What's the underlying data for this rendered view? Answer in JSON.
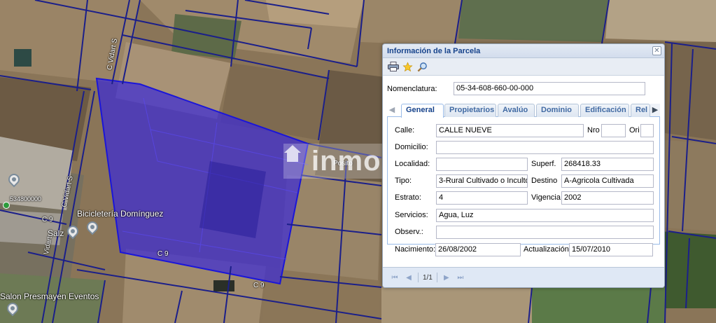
{
  "map": {
    "street_labels": [
      "C Vidart S",
      "C Vidart S",
      "C 9",
      "C 9",
      "C 9",
      "Vidart"
    ],
    "poi_labels": [
      "Bicicletería Domínguez",
      "Salz",
      "Salon Presmayen Eventos",
      "Posito"
    ],
    "parcel_number": "534800000",
    "watermark_text": "inmou",
    "parcel_fill": "#3c2bd6",
    "parcel_border": "#1a15d9",
    "line_color": "#1b1f8a"
  },
  "dialog": {
    "title": "Información de la Parcela",
    "close_icon": "close-icon",
    "toolbar": [
      "print-icon",
      "star-icon",
      "search-icon"
    ],
    "nomenclatura": {
      "label": "Nomenclatura:",
      "value": "05-34-608-660-00-000"
    },
    "tabs": [
      {
        "label": "General",
        "active": true
      },
      {
        "label": "Propietarios",
        "active": false
      },
      {
        "label": "Avalúo",
        "active": false
      },
      {
        "label": "Dominio",
        "active": false
      },
      {
        "label": "Edificación",
        "active": false
      },
      {
        "label": "Rel",
        "active": false
      }
    ],
    "general": {
      "calle_label": "Calle:",
      "calle_value": "CALLE NUEVE",
      "nro_label": "Nro",
      "nro_value": "",
      "ori_label": "Ori",
      "ori_value": "",
      "domicilio_label": "Domicilio:",
      "domicilio_value": "",
      "localidad_label": "Localidad:",
      "localidad_value": "",
      "superf_label": "Superf.",
      "superf_value": "268418.33",
      "tipo_label": "Tipo:",
      "tipo_value": "3-Rural Cultivado o Inculto",
      "destino_label": "Destino",
      "destino_value": "A-Agricola Cultivada",
      "estrato_label": "Estrato:",
      "estrato_value": "4",
      "vigencia_label": "Vigencia",
      "vigencia_value": "2002",
      "servicios_label": "Servicios:",
      "servicios_value": "Agua, Luz",
      "observ_label": "Observ.:",
      "observ_value": "",
      "nacimiento_label": "Nacimiento:",
      "nacimiento_value": "26/08/2002",
      "actualizacion_label": "Actualización",
      "actualizacion_value": "15/07/2010"
    },
    "pager": {
      "text": "1/1"
    }
  }
}
